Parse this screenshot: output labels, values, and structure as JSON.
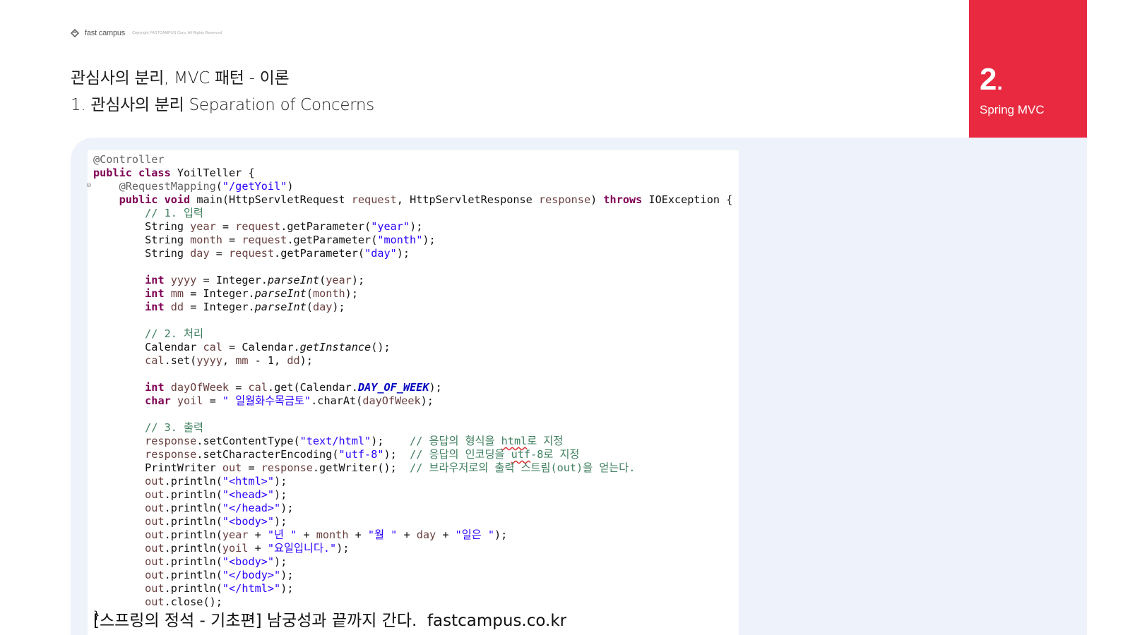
{
  "brand": {
    "name": "fast campus",
    "copyright": "Copyright FASTCAMPUS Corp. All Rights Reserved"
  },
  "title": {
    "line1": "관심사의 분리, MVC 패턴 - 이론",
    "line2": "1. 관심사의 분리 Separation of Concerns"
  },
  "badge": {
    "number": "2",
    "dot": ".",
    "label": "Spring MVC",
    "color": "#e8293f"
  },
  "code": [
    [
      {
        "t": "@Controller",
        "c": "an"
      }
    ],
    [
      {
        "t": "public class",
        "c": "kw"
      },
      {
        "t": " YoilTeller {"
      }
    ],
    [
      {
        "t": "    "
      },
      {
        "t": "@RequestMapping",
        "c": "an"
      },
      {
        "t": "("
      },
      {
        "t": "\"/getYoil\"",
        "c": "st"
      },
      {
        "t": ")"
      }
    ],
    [
      {
        "t": "    "
      },
      {
        "t": "public void",
        "c": "kw"
      },
      {
        "t": " main(HttpServletRequest "
      },
      {
        "t": "request",
        "c": "vr"
      },
      {
        "t": ", HttpServletResponse "
      },
      {
        "t": "response",
        "c": "vr"
      },
      {
        "t": ") "
      },
      {
        "t": "throws",
        "c": "kw"
      },
      {
        "t": " IOException {"
      }
    ],
    [
      {
        "t": "        "
      },
      {
        "t": "// 1. 입력",
        "c": "cm"
      }
    ],
    [
      {
        "t": "        String "
      },
      {
        "t": "year",
        "c": "vr"
      },
      {
        "t": " = "
      },
      {
        "t": "request",
        "c": "vr"
      },
      {
        "t": ".getParameter("
      },
      {
        "t": "\"year\"",
        "c": "st"
      },
      {
        "t": ");"
      }
    ],
    [
      {
        "t": "        String "
      },
      {
        "t": "month",
        "c": "vr"
      },
      {
        "t": " = "
      },
      {
        "t": "request",
        "c": "vr"
      },
      {
        "t": ".getParameter("
      },
      {
        "t": "\"month\"",
        "c": "st"
      },
      {
        "t": ");"
      }
    ],
    [
      {
        "t": "        String "
      },
      {
        "t": "day",
        "c": "vr"
      },
      {
        "t": " = "
      },
      {
        "t": "request",
        "c": "vr"
      },
      {
        "t": ".getParameter("
      },
      {
        "t": "\"day\"",
        "c": "st"
      },
      {
        "t": ");"
      }
    ],
    [
      {
        "t": ""
      }
    ],
    [
      {
        "t": "        "
      },
      {
        "t": "int",
        "c": "kw"
      },
      {
        "t": " "
      },
      {
        "t": "yyyy",
        "c": "vr"
      },
      {
        "t": " = Integer."
      },
      {
        "t": "parseInt",
        "c": "it"
      },
      {
        "t": "("
      },
      {
        "t": "year",
        "c": "vr"
      },
      {
        "t": ");"
      }
    ],
    [
      {
        "t": "        "
      },
      {
        "t": "int",
        "c": "kw"
      },
      {
        "t": " "
      },
      {
        "t": "mm",
        "c": "vr"
      },
      {
        "t": " = Integer."
      },
      {
        "t": "parseInt",
        "c": "it"
      },
      {
        "t": "("
      },
      {
        "t": "month",
        "c": "vr"
      },
      {
        "t": ");"
      }
    ],
    [
      {
        "t": "        "
      },
      {
        "t": "int",
        "c": "kw"
      },
      {
        "t": " "
      },
      {
        "t": "dd",
        "c": "vr"
      },
      {
        "t": " = Integer."
      },
      {
        "t": "parseInt",
        "c": "it"
      },
      {
        "t": "("
      },
      {
        "t": "day",
        "c": "vr"
      },
      {
        "t": ");"
      }
    ],
    [
      {
        "t": ""
      }
    ],
    [
      {
        "t": "        "
      },
      {
        "t": "// 2. 처리",
        "c": "cm"
      }
    ],
    [
      {
        "t": "        Calendar "
      },
      {
        "t": "cal",
        "c": "vr"
      },
      {
        "t": " = Calendar."
      },
      {
        "t": "getInstance",
        "c": "it"
      },
      {
        "t": "();"
      }
    ],
    [
      {
        "t": "        "
      },
      {
        "t": "cal",
        "c": "vr"
      },
      {
        "t": ".set("
      },
      {
        "t": "yyyy",
        "c": "vr"
      },
      {
        "t": ", "
      },
      {
        "t": "mm",
        "c": "vr"
      },
      {
        "t": " - 1, "
      },
      {
        "t": "dd",
        "c": "vr"
      },
      {
        "t": ");"
      }
    ],
    [
      {
        "t": ""
      }
    ],
    [
      {
        "t": "        "
      },
      {
        "t": "int",
        "c": "kw"
      },
      {
        "t": " "
      },
      {
        "t": "dayOfWeek",
        "c": "vr"
      },
      {
        "t": " = "
      },
      {
        "t": "cal",
        "c": "vr"
      },
      {
        "t": ".get(Calendar."
      },
      {
        "t": "DAY_OF_WEEK",
        "c": "cn"
      },
      {
        "t": ");"
      }
    ],
    [
      {
        "t": "        "
      },
      {
        "t": "char",
        "c": "kw"
      },
      {
        "t": " "
      },
      {
        "t": "yoil",
        "c": "vr"
      },
      {
        "t": " = "
      },
      {
        "t": "\" 일월화수목금토\"",
        "c": "st"
      },
      {
        "t": ".charAt("
      },
      {
        "t": "dayOfWeek",
        "c": "vr"
      },
      {
        "t": ");"
      }
    ],
    [
      {
        "t": ""
      }
    ],
    [
      {
        "t": "        "
      },
      {
        "t": "// 3. 출력",
        "c": "cm"
      }
    ],
    [
      {
        "t": "        "
      },
      {
        "t": "response",
        "c": "vr"
      },
      {
        "t": ".setContentType("
      },
      {
        "t": "\"text/html\"",
        "c": "st"
      },
      {
        "t": ");    "
      },
      {
        "t": "// 응답의 형식을 ",
        "c": "cm"
      },
      {
        "t": "html",
        "c": "cm squig"
      },
      {
        "t": "로 지정",
        "c": "cm"
      }
    ],
    [
      {
        "t": "        "
      },
      {
        "t": "response",
        "c": "vr"
      },
      {
        "t": ".setCharacterEncoding("
      },
      {
        "t": "\"utf-8\"",
        "c": "st"
      },
      {
        "t": ");  "
      },
      {
        "t": "// 응답의 인코딩을 ",
        "c": "cm"
      },
      {
        "t": "utf",
        "c": "cm squig"
      },
      {
        "t": "-8로 지정",
        "c": "cm"
      }
    ],
    [
      {
        "t": "        PrintWriter "
      },
      {
        "t": "out",
        "c": "vr"
      },
      {
        "t": " = "
      },
      {
        "t": "response",
        "c": "vr"
      },
      {
        "t": ".getWriter();  "
      },
      {
        "t": "// 브라우저로의 출력 스트림(out)을 얻는다.",
        "c": "cm"
      }
    ],
    [
      {
        "t": "        "
      },
      {
        "t": "out",
        "c": "vr"
      },
      {
        "t": ".println("
      },
      {
        "t": "\"<html>\"",
        "c": "st"
      },
      {
        "t": ");"
      }
    ],
    [
      {
        "t": "        "
      },
      {
        "t": "out",
        "c": "vr"
      },
      {
        "t": ".println("
      },
      {
        "t": "\"<head>\"",
        "c": "st"
      },
      {
        "t": ");"
      }
    ],
    [
      {
        "t": "        "
      },
      {
        "t": "out",
        "c": "vr"
      },
      {
        "t": ".println("
      },
      {
        "t": "\"</head>\"",
        "c": "st"
      },
      {
        "t": ");"
      }
    ],
    [
      {
        "t": "        "
      },
      {
        "t": "out",
        "c": "vr"
      },
      {
        "t": ".println("
      },
      {
        "t": "\"<body>\"",
        "c": "st"
      },
      {
        "t": ");"
      }
    ],
    [
      {
        "t": "        "
      },
      {
        "t": "out",
        "c": "vr"
      },
      {
        "t": ".println("
      },
      {
        "t": "year",
        "c": "vr"
      },
      {
        "t": " + "
      },
      {
        "t": "\"년 \"",
        "c": "st"
      },
      {
        "t": " + "
      },
      {
        "t": "month",
        "c": "vr"
      },
      {
        "t": " + "
      },
      {
        "t": "\"월 \"",
        "c": "st"
      },
      {
        "t": " + "
      },
      {
        "t": "day",
        "c": "vr"
      },
      {
        "t": " + "
      },
      {
        "t": "\"일은 \"",
        "c": "st"
      },
      {
        "t": ");"
      }
    ],
    [
      {
        "t": "        "
      },
      {
        "t": "out",
        "c": "vr"
      },
      {
        "t": ".println("
      },
      {
        "t": "yoil",
        "c": "vr"
      },
      {
        "t": " + "
      },
      {
        "t": "\"요일입니다.\"",
        "c": "st"
      },
      {
        "t": ");"
      }
    ],
    [
      {
        "t": "        "
      },
      {
        "t": "out",
        "c": "vr"
      },
      {
        "t": ".println("
      },
      {
        "t": "\"<body>\"",
        "c": "st"
      },
      {
        "t": ");"
      }
    ],
    [
      {
        "t": "        "
      },
      {
        "t": "out",
        "c": "vr"
      },
      {
        "t": ".println("
      },
      {
        "t": "\"</body>\"",
        "c": "st"
      },
      {
        "t": ");"
      }
    ],
    [
      {
        "t": "        "
      },
      {
        "t": "out",
        "c": "vr"
      },
      {
        "t": ".println("
      },
      {
        "t": "\"</html>\"",
        "c": "st"
      },
      {
        "t": ");"
      }
    ],
    [
      {
        "t": "        "
      },
      {
        "t": "out",
        "c": "vr"
      },
      {
        "t": ".close();"
      }
    ],
    [
      {
        "t": "}"
      }
    ]
  ],
  "footer": {
    "caption": "[스프링의 정석 - 기초편] 남궁성과 끝까지 간다.  fastcampus.co.kr"
  }
}
